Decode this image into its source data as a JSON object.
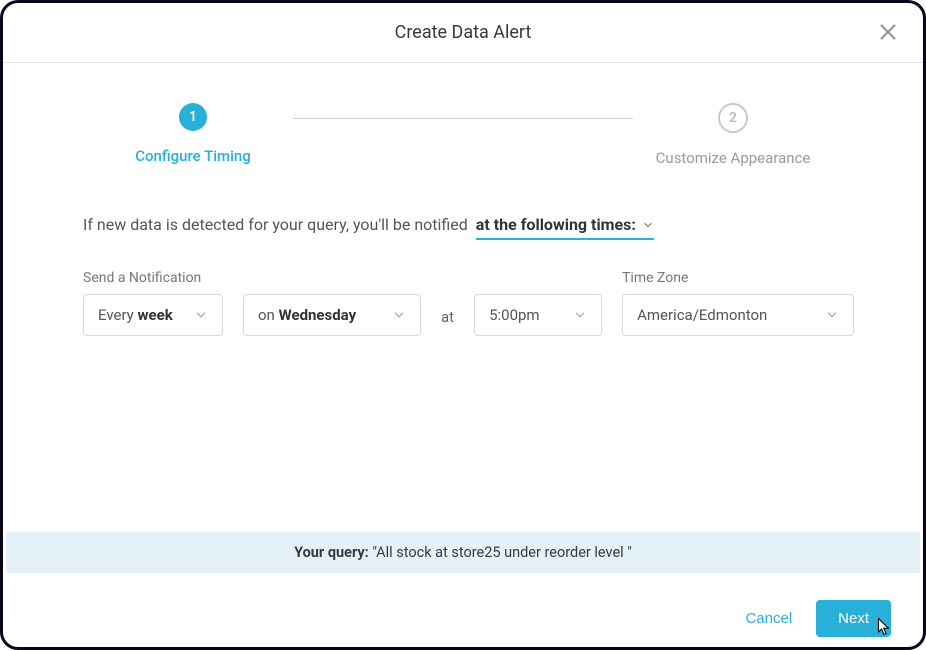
{
  "header": {
    "title": "Create Data Alert"
  },
  "steps": {
    "step1": {
      "num": "1",
      "label": "Configure Timing"
    },
    "step2": {
      "num": "2",
      "label": "Customize Appearance"
    }
  },
  "intro": {
    "text": "If new data is detected for your query, you'll be notified",
    "trigger_label": "at the following times:"
  },
  "form": {
    "notification_label": "Send a Notification",
    "timezone_label": "Time Zone",
    "freq_prefix": "Every",
    "freq_bold": "week",
    "day_prefix": "on",
    "day_bold": "Wednesday",
    "at_label": "at",
    "time": "5:00pm",
    "timezone": "America/Edmonton"
  },
  "query": {
    "label": "Your query:",
    "text": "\"All stock at store25 under reorder level \""
  },
  "footer": {
    "cancel": "Cancel",
    "next": "Next"
  }
}
